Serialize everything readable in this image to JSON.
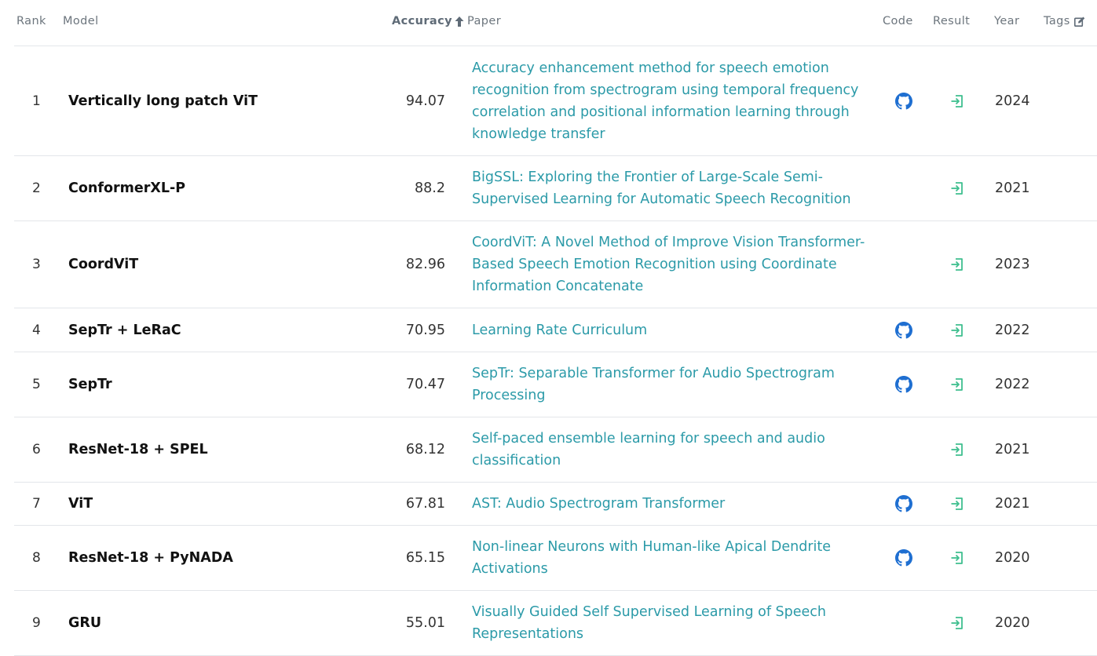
{
  "header": {
    "rank": "Rank",
    "model": "Model",
    "accuracy": "Accuracy",
    "paper": "Paper",
    "code": "Code",
    "result": "Result",
    "year": "Year",
    "tags": "Tags"
  },
  "colors": {
    "link": "#2b9aa8",
    "github": "#1f6fd1",
    "result_icon": "#3fbf8f"
  },
  "rows": [
    {
      "rank": "1",
      "model": "Vertically long patch ViT",
      "accuracy": "94.07",
      "paper": "Accuracy enhancement method for speech emotion recognition from spectrogram using temporal frequency correlation and positional information learning through knowledge transfer",
      "code": true,
      "year": "2024"
    },
    {
      "rank": "2",
      "model": "ConformerXL-P",
      "accuracy": "88.2",
      "paper": "BigSSL: Exploring the Frontier of Large-Scale Semi-Supervised Learning for Automatic Speech Recognition",
      "code": false,
      "year": "2021"
    },
    {
      "rank": "3",
      "model": "CoordViT",
      "accuracy": "82.96",
      "paper": "CoordViT: A Novel Method of Improve Vision Transformer-Based Speech Emotion Recognition using Coordinate Information Concatenate",
      "code": false,
      "year": "2023"
    },
    {
      "rank": "4",
      "model": "SepTr + LeRaC",
      "accuracy": "70.95",
      "paper": "Learning Rate Curriculum",
      "code": true,
      "year": "2022"
    },
    {
      "rank": "5",
      "model": "SepTr",
      "accuracy": "70.47",
      "paper": "SepTr: Separable Transformer for Audio Spectrogram Processing",
      "code": true,
      "year": "2022"
    },
    {
      "rank": "6",
      "model": "ResNet-18 + SPEL",
      "accuracy": "68.12",
      "paper": "Self-paced ensemble learning for speech and audio classification",
      "code": false,
      "year": "2021"
    },
    {
      "rank": "7",
      "model": "ViT",
      "accuracy": "67.81",
      "paper": "AST: Audio Spectrogram Transformer",
      "code": true,
      "year": "2021"
    },
    {
      "rank": "8",
      "model": "ResNet-18 + PyNADA",
      "accuracy": "65.15",
      "paper": "Non-linear Neurons with Human-like Apical Dendrite Activations",
      "code": true,
      "year": "2020"
    },
    {
      "rank": "9",
      "model": "GRU",
      "accuracy": "55.01",
      "paper": "Visually Guided Self Supervised Learning of Speech Representations",
      "code": false,
      "year": "2020"
    }
  ]
}
